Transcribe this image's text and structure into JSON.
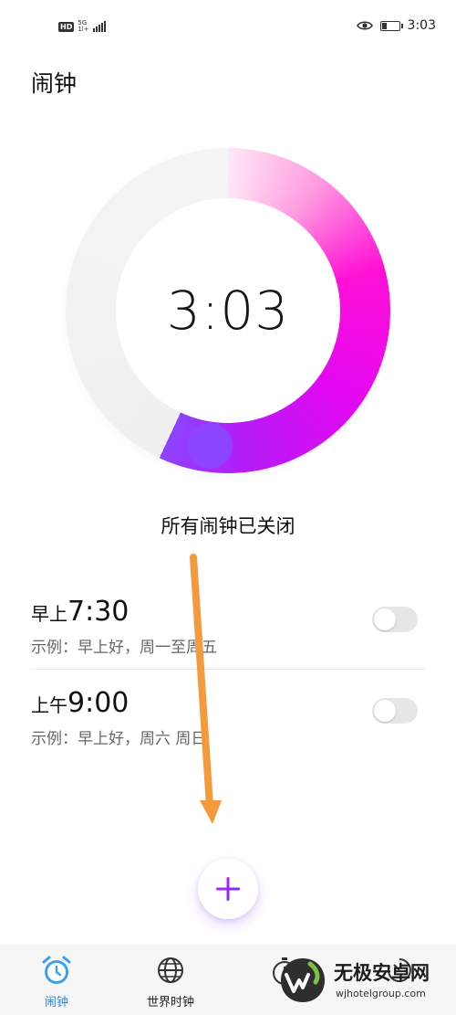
{
  "status_bar": {
    "hd": "HD",
    "net_top": "5G",
    "net_bottom": "1l+",
    "time": "3:03"
  },
  "page": {
    "title": "闹钟"
  },
  "clock": {
    "time": "3:03",
    "progress_fraction": 0.57
  },
  "alarm_status": "所有闹钟已关闭",
  "alarms": [
    {
      "period": "早上",
      "time": "7:30",
      "desc": "示例：早上好，周一至周五",
      "enabled": false
    },
    {
      "period": "上午",
      "time": "9:00",
      "desc": "示例：早上好，周六 周日",
      "enabled": false
    }
  ],
  "fab": {
    "icon": "plus-icon"
  },
  "nav": {
    "items": [
      {
        "label": "闹钟",
        "icon": "alarm-clock-icon",
        "active": true
      },
      {
        "label": "世界时钟",
        "icon": "globe-icon",
        "active": false
      },
      {
        "label": "",
        "icon": "stopwatch-icon",
        "active": false
      },
      {
        "label": "",
        "icon": "timer-icon",
        "active": false
      }
    ]
  },
  "watermark": {
    "text": "无极安卓网",
    "url": "wjhotelgroup.com"
  },
  "colors": {
    "accent_magenta": "#ff10d6",
    "accent_purple": "#8c44ff",
    "annotation_arrow": "#f59a3c",
    "nav_active": "#2f86d8"
  }
}
